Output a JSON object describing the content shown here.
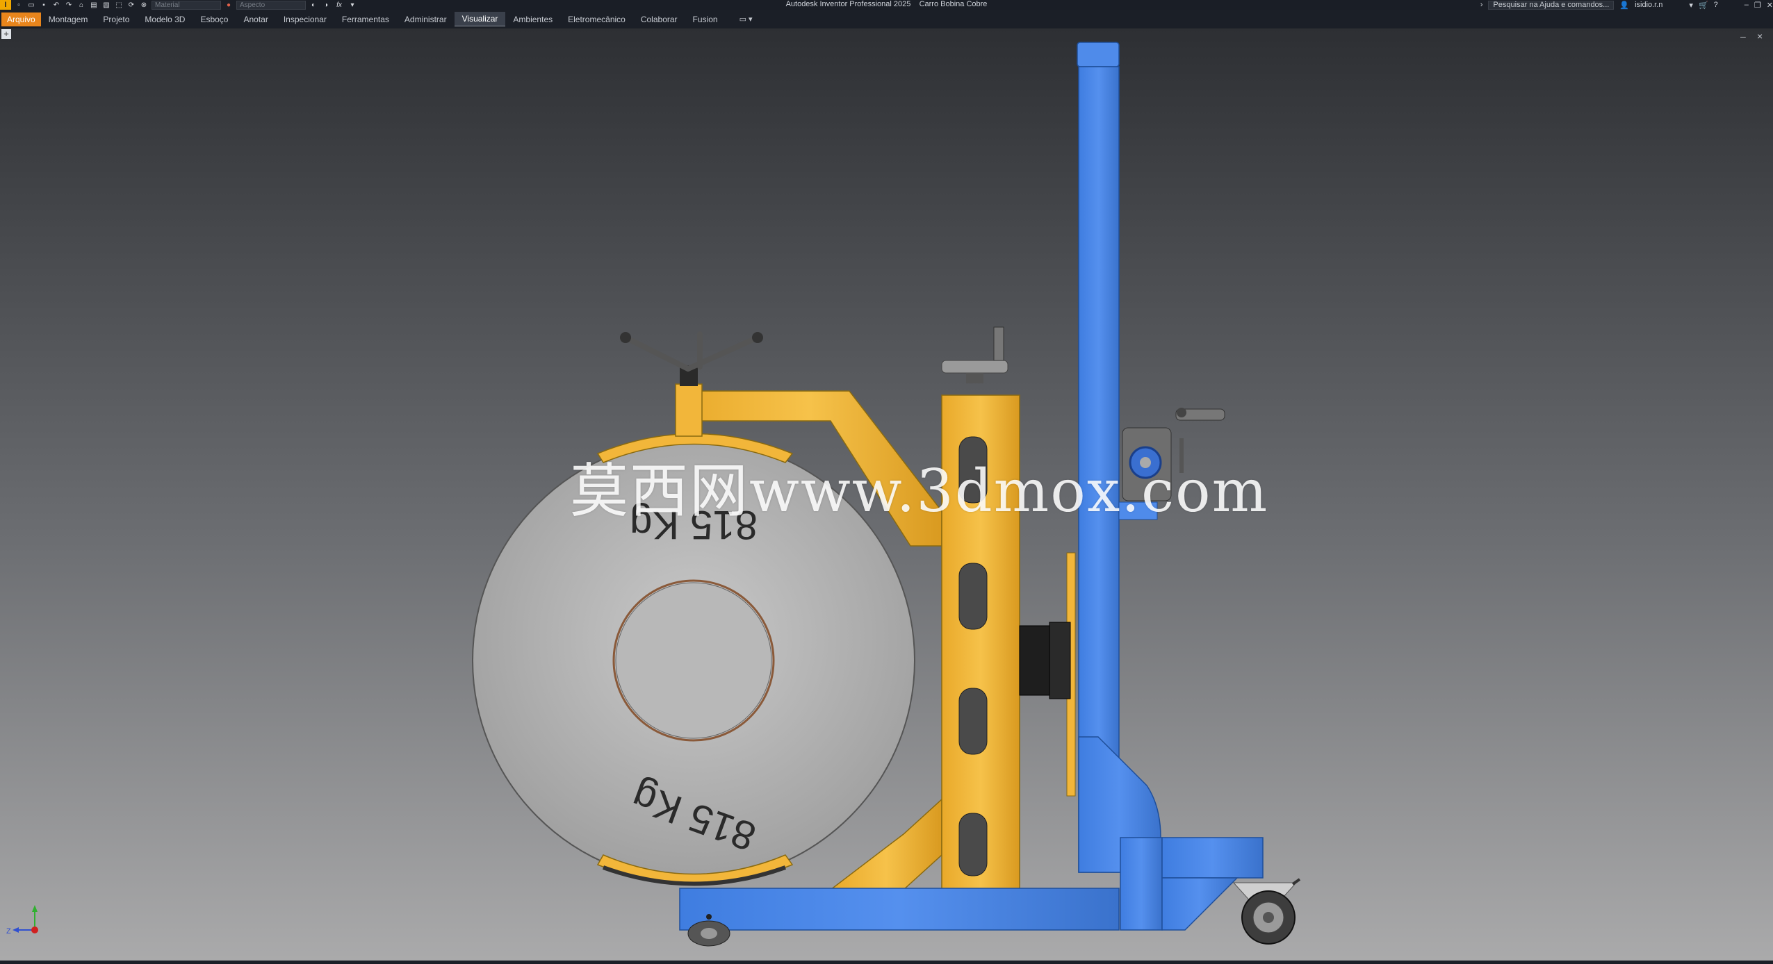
{
  "title": {
    "app_name": "Autodesk Inventor Professional 2025",
    "document": "Carro Bobina Cobre",
    "material_placeholder": "Material",
    "appearance_placeholder": "Aspecto",
    "fx_label": "fx",
    "search_placeholder": "Pesquisar na Ajuda e comandos...",
    "user_name": "isidio.r.n"
  },
  "menu": {
    "items": [
      "Arquivo",
      "Montagem",
      "Projeto",
      "Modelo 3D",
      "Esboço",
      "Anotar",
      "Inspecionar",
      "Ferramentas",
      "Administrar",
      "Visualizar",
      "Ambientes",
      "Eletromecânico",
      "Colaborar",
      "Fusion"
    ],
    "active": "Visualizar"
  },
  "scene": {
    "coil_label_top": "815 Kg",
    "coil_label_bottom": "815 Kg",
    "colors": {
      "frame_blue": "#4a86e8",
      "arm_yellow": "#f2b63a",
      "coil_gray": "#b8b8b8"
    }
  },
  "watermark": "莫西网www.3dmox.com",
  "triad": {
    "z_label": "Z"
  }
}
